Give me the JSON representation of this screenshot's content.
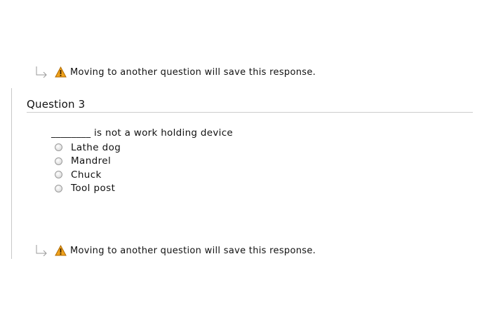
{
  "save_note_top": {
    "icon_arrow": "return-arrow-icon",
    "icon_warning": "warning-icon",
    "text": "Moving to another question will save this response."
  },
  "question": {
    "title": "Question 3",
    "text": "________ is not a work holding device",
    "options": [
      {
        "label": "Lathe dog",
        "selected": false
      },
      {
        "label": "Mandrel",
        "selected": false
      },
      {
        "label": "Chuck",
        "selected": false
      },
      {
        "label": "Tool post",
        "selected": false
      }
    ]
  },
  "save_note_bottom": {
    "icon_arrow": "return-arrow-icon",
    "icon_warning": "warning-icon",
    "text": "Moving to another question will save this response."
  },
  "colors": {
    "warning_fill": "#f0a21c",
    "warning_stroke": "#b06a00",
    "divider": "#cccccc",
    "arrow": "#9a9a9a"
  }
}
